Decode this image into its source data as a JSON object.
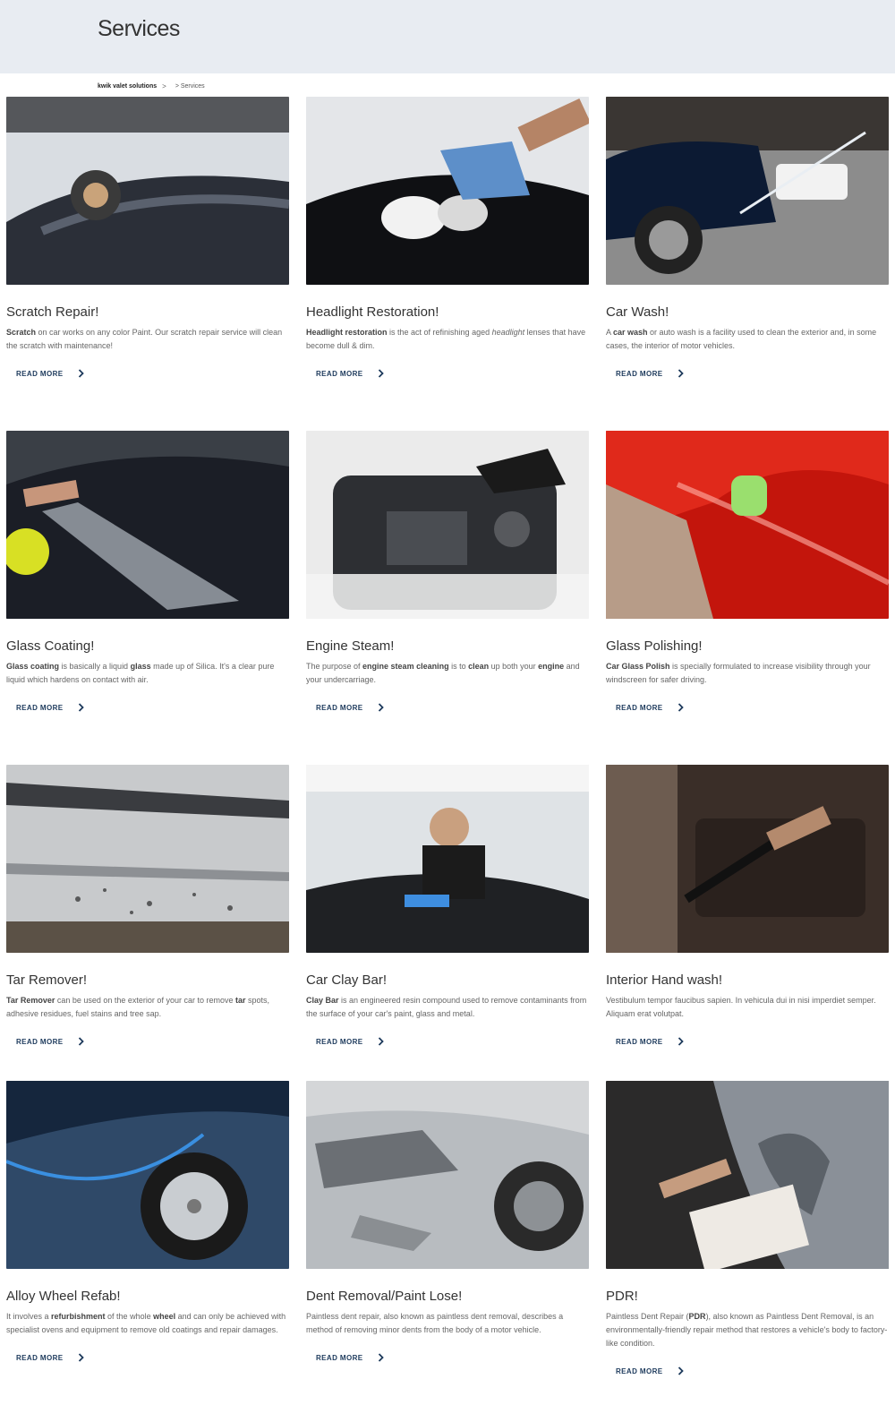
{
  "header": {
    "title": "Services"
  },
  "breadcrumb": {
    "home": "kwik valet solutions",
    "separator": ">",
    "current": "> Services"
  },
  "read_more_label": "READ MORE",
  "services": [
    {
      "title": "Scratch Repair!",
      "desc_html": "<b>Scratch</b> on car works on any color Paint. Our scratch repair service will clean the scratch with maintenance!",
      "image": "car-polishing-photo"
    },
    {
      "title": "Headlight Restoration!",
      "desc_html": "<b>Headlight restoration</b>  is the act of refinishing aged <i>headlight</i> lenses that have become dull &amp; dim.",
      "image": "headlight-cleaning-photo"
    },
    {
      "title": "Car Wash!",
      "desc_html": "A <b>car wash</b> or auto wash is a facility used to clean the exterior and, in some cases, the interior of motor vehicles.",
      "image": "pressure-washing-photo"
    },
    {
      "title": "Glass Coating!",
      "desc_html": "<b>Glass coating</b> is basically a liquid <b>glass</b> made up of Silica. It's a clear pure liquid which hardens  on contact with air.",
      "image": "coating-spray-photo"
    },
    {
      "title": "Engine Steam!",
      "desc_html": "The purpose of <b>engine steam cleaning</b> is to <b>clean</b> up both your <b>engine</b> and your undercarriage.",
      "image": "engine-cleaning-photo"
    },
    {
      "title": "Glass Polishing!",
      "desc_html": "<b>Car Glass Polish</b> is specially formulated to increase visibility through your windscreen for safer driving.",
      "image": "red-car-polishing-photo"
    },
    {
      "title": "Tar Remover!",
      "desc_html": "<b>Tar Remover</b> can be used on the exterior of your car to remove <b>tar</b> spots, adhesive residues, fuel stains and tree sap.",
      "image": "tar-spots-photo"
    },
    {
      "title": "Car Clay Bar!",
      "desc_html": "<b>Clay Bar</b> is an engineered resin compound used to remove contaminants from the surface of your car's paint, glass and metal.",
      "image": "clay-bar-photo"
    },
    {
      "title": "Interior Hand wash!",
      "desc_html": "Vestibulum tempor faucibus sapien. In vehicula dui in nisi imperdiet semper. Aliquam erat volutpat.",
      "image": "interior-vacuum-photo"
    },
    {
      "title": "Alloy Wheel Refab!",
      "desc_html": "It involves a <b>refurbishment</b> of the whole <b>wheel</b> and can only be achieved with specialist ovens and equipment to remove old coatings and repair damages.",
      "image": "wheel-washing-photo"
    },
    {
      "title": "Dent Removal/Paint Lose!",
      "desc_html": "Paintless dent repair, also known as paintless dent removal, describes a method of removing minor dents from the body of a motor vehicle.",
      "image": "dented-bumper-photo"
    },
    {
      "title": "PDR!",
      "desc_html": "Paintless Dent Repair (<b>PDR</b>), also known as Paintless Dent Removal, is an environmentally-friendly repair method that restores a vehicle's body to factory-like condition.",
      "image": "damage-inspection-photo"
    }
  ],
  "colors": {
    "hero_bg": "#e8ecf2",
    "link": "#1d3a5c",
    "text": "#333333",
    "muted": "#666666"
  }
}
